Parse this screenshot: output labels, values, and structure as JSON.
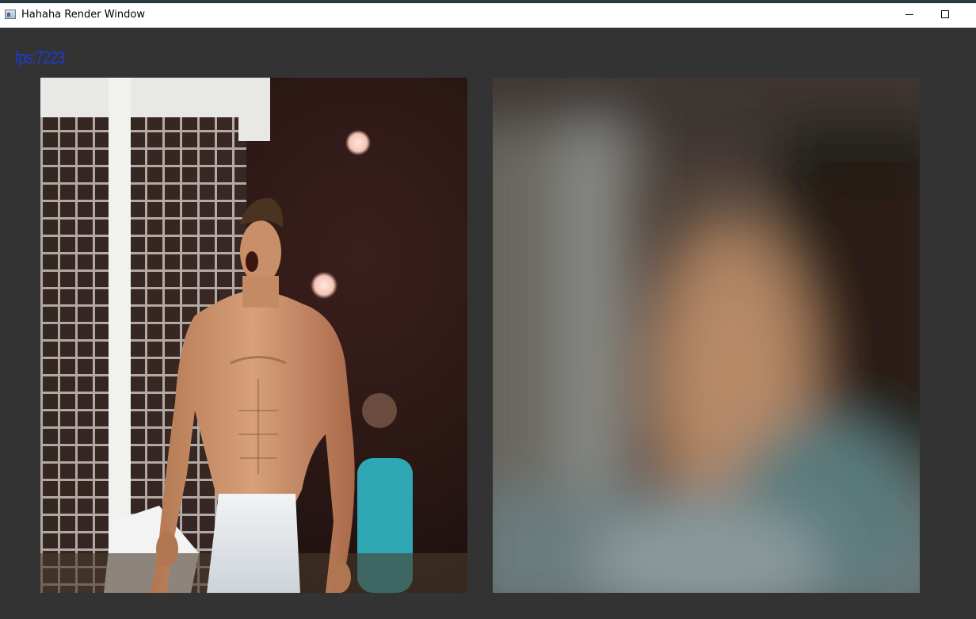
{
  "window": {
    "title": "Hahaha Render Window",
    "icon": "app-window-icon",
    "controls": {
      "minimize_icon": "minimize-icon",
      "maximize_icon": "maximize-icon"
    }
  },
  "overlay": {
    "fps_text": "fps:7223",
    "fps_color": "#1f3bd6"
  },
  "panels": [
    {
      "name": "original-image",
      "content": "photo of shirtless soccer player celebrating in stadium"
    },
    {
      "name": "blurred-image",
      "content": "heavily blurred version of the same photo"
    }
  ],
  "colors": {
    "background": "#333333",
    "titlebar": "#ffffff"
  }
}
